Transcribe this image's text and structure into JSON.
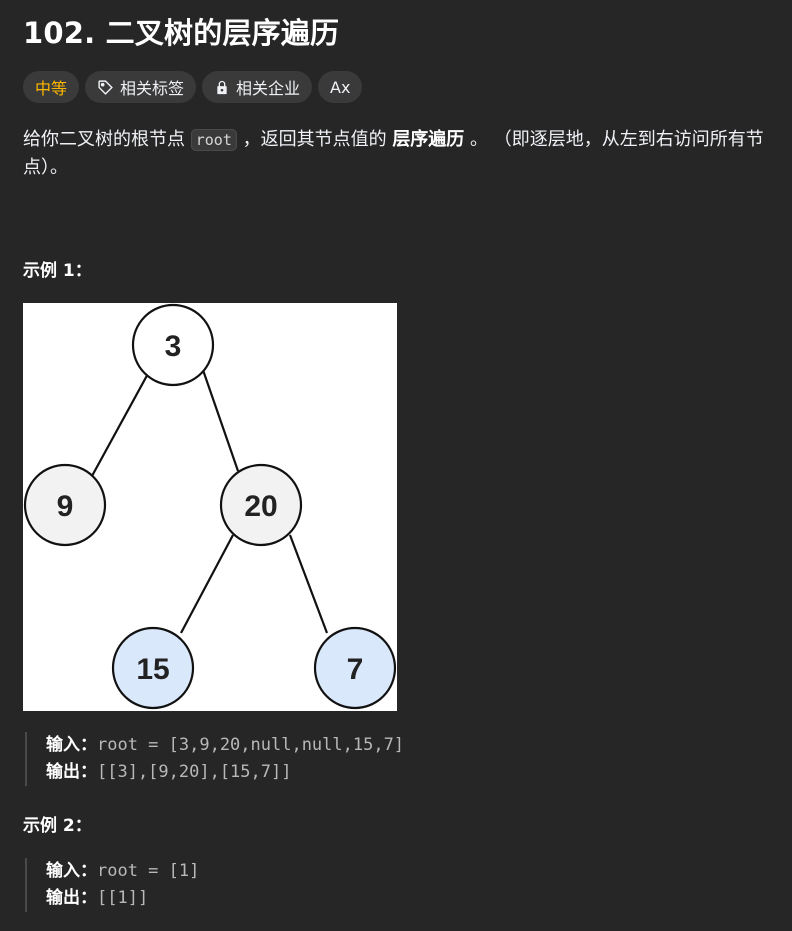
{
  "problem": {
    "title": "102. 二叉树的层序遍历"
  },
  "tags": {
    "difficulty": "中等",
    "related_tags": "相关标签",
    "related_companies": "相关企业",
    "font_icon_label": "Ax"
  },
  "description": {
    "part1": "给你二叉树的根节点 ",
    "code": "root",
    "part2": " ，返回其节点值的 ",
    "bold": "层序遍历",
    "part3": " 。 （即逐层地，从左到右访问所有节点）。"
  },
  "example1": {
    "title": "示例 1：",
    "tree_nodes": [
      "3",
      "9",
      "20",
      "15",
      "7"
    ],
    "input_label": "输入：",
    "input_value": "root = [3,9,20,null,null,15,7]",
    "output_label": "输出：",
    "output_value": "[[3],[9,20],[15,7]]"
  },
  "example2": {
    "title": "示例 2：",
    "input_label": "输入：",
    "input_value": "root = [1]",
    "output_label": "输出：",
    "output_value": "[[1]]"
  },
  "colors": {
    "difficulty": "#ffb800",
    "node_gray": "#f2f2f2",
    "node_blue": "#dae8fc"
  }
}
